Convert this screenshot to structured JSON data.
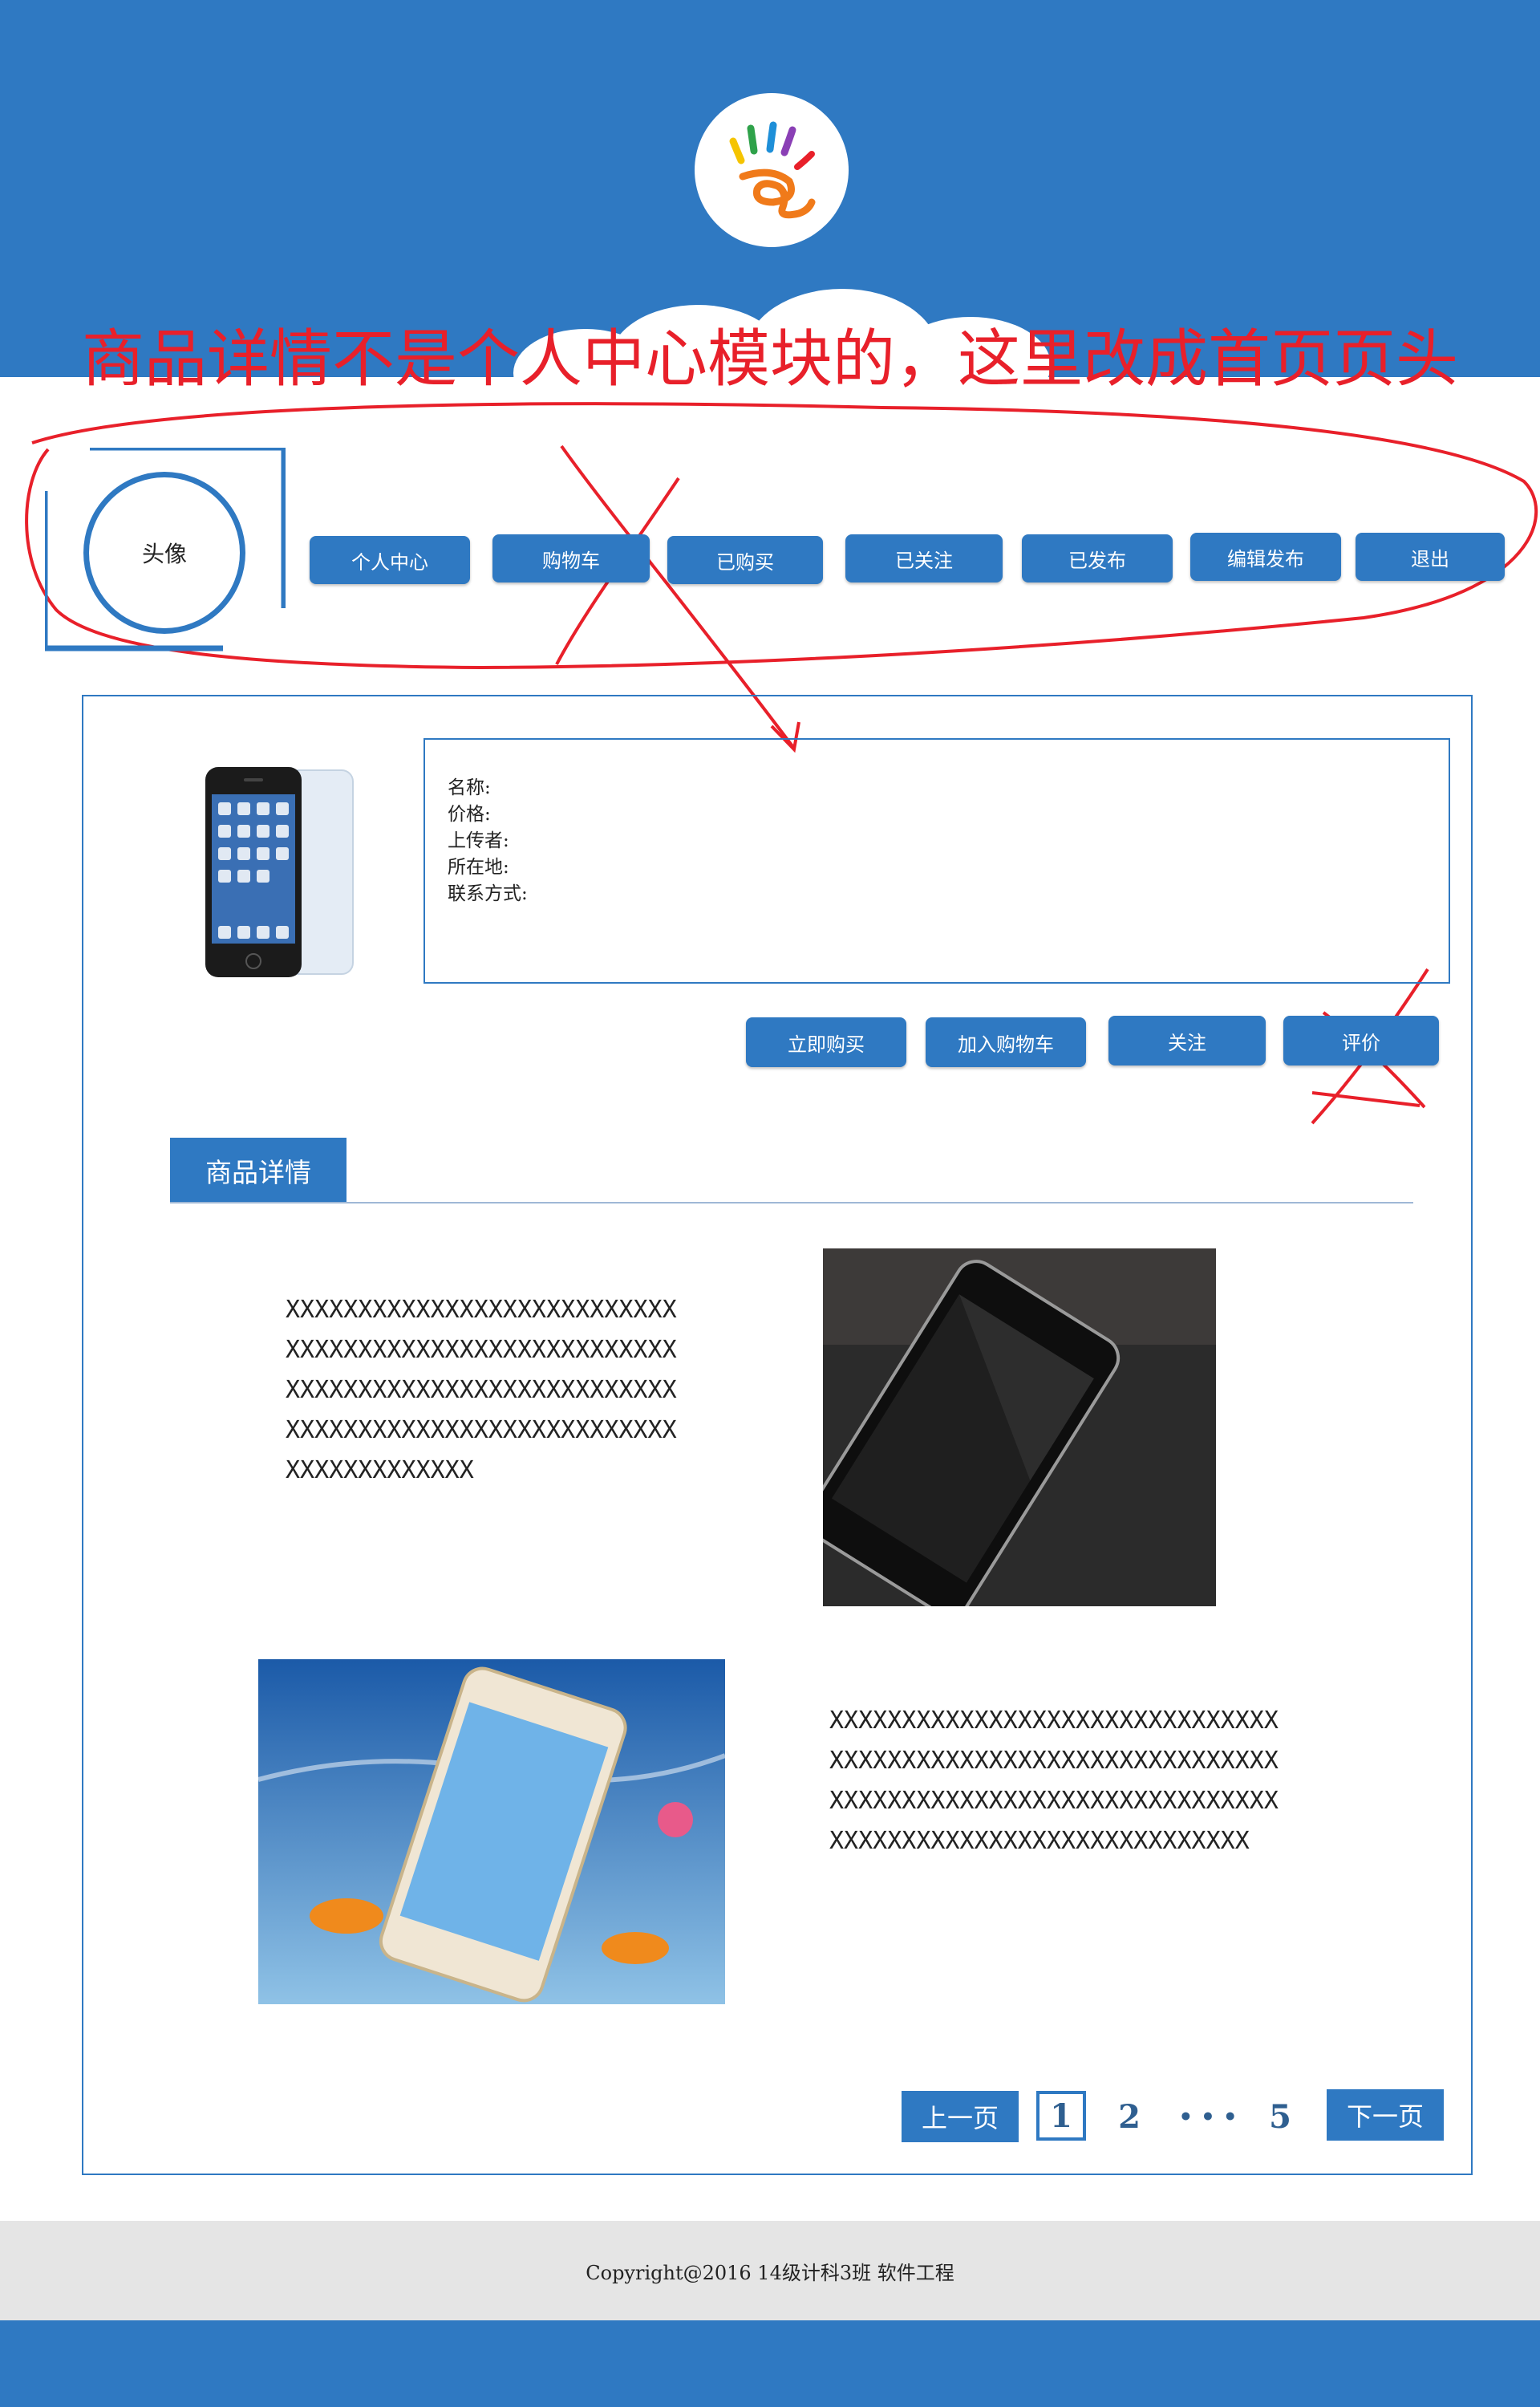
{
  "colors": {
    "brand_blue": "#2f79c2",
    "annotation_red": "#e8202a",
    "footer_gray": "#e5e5e5"
  },
  "annotation": {
    "text": "商品详情不是个人中心模块的，这里改成首页页头"
  },
  "nav": {
    "avatar_label": "头像",
    "buttons": [
      "个人中心",
      "购物车",
      "已购买",
      "已关注",
      "已发布",
      "编辑发布",
      "退出"
    ]
  },
  "product": {
    "info": {
      "name_label": "名称:",
      "price_label": "价格:",
      "uploader_label": "上传者:",
      "location_label": "所在地:",
      "contact_label": "联系方式:"
    },
    "actions": {
      "buy_now": "立即购买",
      "add_cart": "加入购物车",
      "follow": "关注",
      "review": "评价"
    }
  },
  "details": {
    "section_title": "商品详情",
    "text_block_1": "XXXXXXXXXXXXXXXXXXXXXXXXXXXXXXXXXXXXXXXXXXXXXXXXXXXXXXXXXXXXXXXXXXXXXXXXXXXXXXXXXXXXXXXXXXXXXXXXXXXXXXXXXXXXXXXXXXXXXXXXX",
    "text_block_2": "XXXXXXXXXXXXXXXXXXXXXXXXXXXXXXXXXXXXXXXXXXXXXXXXXXXXXXXXXXXXXXXXXXXXXXXXXXXXXXXXXXXXXXXXXXXXXXXXXXXXXXXXXXXXXXXXXXXXXXXXXX"
  },
  "pagination": {
    "prev": "上一页",
    "current": "1",
    "page2": "2",
    "ellipsis": "• • •",
    "last": "5",
    "next": "下一页"
  },
  "footer": {
    "copyright": "Copyright@2016  14级计科3班  软件工程"
  }
}
